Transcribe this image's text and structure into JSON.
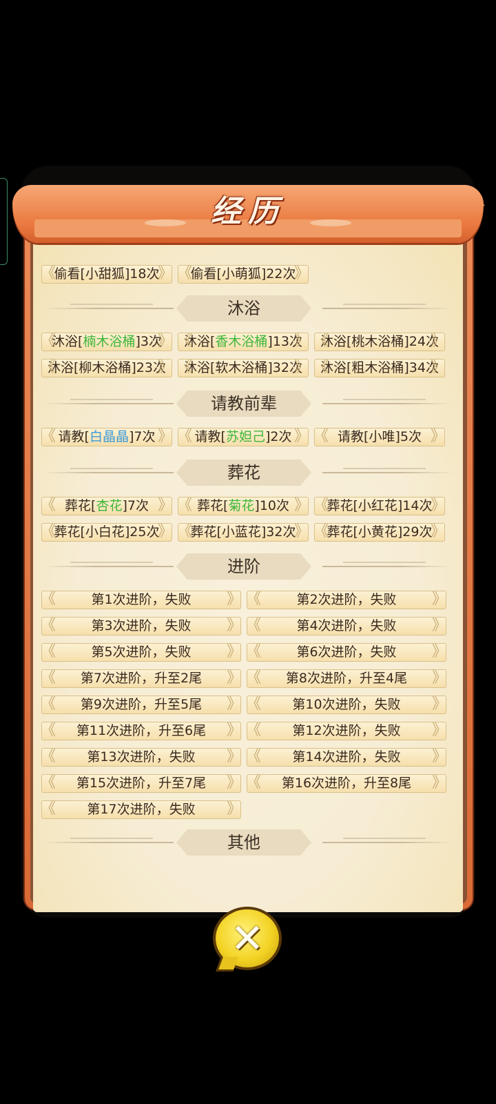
{
  "dialog": {
    "title": "经历",
    "close_icon_name": "close-icon"
  },
  "top_partial": [
    {
      "label": "偷看[小甜狐]18次"
    },
    {
      "label": "偷看[小萌狐]22次"
    }
  ],
  "sections": [
    {
      "title": "沐浴",
      "items": [
        {
          "prefix": "沐浴[",
          "highlight": "楠木浴桶",
          "color": "green",
          "suffix": "]3次"
        },
        {
          "prefix": "沐浴[",
          "highlight": "香木浴桶",
          "color": "green",
          "suffix": "]13次"
        },
        {
          "prefix": "沐浴[桃木浴桶]24次",
          "highlight": "",
          "color": "",
          "suffix": ""
        },
        {
          "prefix": "沐浴[柳木浴桶]23次",
          "highlight": "",
          "color": "",
          "suffix": ""
        },
        {
          "prefix": "沐浴[软木浴桶]32次",
          "highlight": "",
          "color": "",
          "suffix": ""
        },
        {
          "prefix": "沐浴[粗木浴桶]34次",
          "highlight": "",
          "color": "",
          "suffix": ""
        }
      ]
    },
    {
      "title": "请教前辈",
      "items": [
        {
          "prefix": "请教[",
          "highlight": "白晶晶",
          "color": "blue",
          "suffix": "]7次"
        },
        {
          "prefix": "请教[",
          "highlight": "苏妲己",
          "color": "green",
          "suffix": "]2次"
        },
        {
          "prefix": "请教[小唯]5次",
          "highlight": "",
          "color": "",
          "suffix": ""
        }
      ]
    },
    {
      "title": "葬花",
      "items": [
        {
          "prefix": "葬花[",
          "highlight": "杏花",
          "color": "green",
          "suffix": "]7次"
        },
        {
          "prefix": "葬花[",
          "highlight": "菊花",
          "color": "green",
          "suffix": "]10次"
        },
        {
          "prefix": "葬花[小红花]14次",
          "highlight": "",
          "color": "",
          "suffix": ""
        },
        {
          "prefix": "葬花[小白花]25次",
          "highlight": "",
          "color": "",
          "suffix": ""
        },
        {
          "prefix": "葬花[小蓝花]32次",
          "highlight": "",
          "color": "",
          "suffix": ""
        },
        {
          "prefix": "葬花[小黄花]29次",
          "highlight": "",
          "color": "",
          "suffix": ""
        }
      ]
    },
    {
      "title": "进阶",
      "items": [
        {
          "prefix": "第1次进阶，失败"
        },
        {
          "prefix": "第2次进阶，失败"
        },
        {
          "prefix": "第3次进阶，失败"
        },
        {
          "prefix": "第4次进阶，失败"
        },
        {
          "prefix": "第5次进阶，失败"
        },
        {
          "prefix": "第6次进阶，失败"
        },
        {
          "prefix": "第7次进阶，升至2尾"
        },
        {
          "prefix": "第8次进阶，升至4尾"
        },
        {
          "prefix": "第9次进阶，升至5尾"
        },
        {
          "prefix": "第10次进阶，失败"
        },
        {
          "prefix": "第11次进阶，升至6尾"
        },
        {
          "prefix": "第12次进阶，失败"
        },
        {
          "prefix": "第13次进阶，失败"
        },
        {
          "prefix": "第14次进阶，失败"
        },
        {
          "prefix": "第15次进阶，升至7尾"
        },
        {
          "prefix": "第16次进阶，升至8尾"
        },
        {
          "prefix": "第17次进阶，失败"
        }
      ]
    },
    {
      "title": "其他",
      "items": []
    }
  ],
  "colors": {
    "green": "#3fb63a",
    "blue": "#3b9ad8",
    "frame": "#e67a45",
    "parchment": "#f7edd5"
  }
}
